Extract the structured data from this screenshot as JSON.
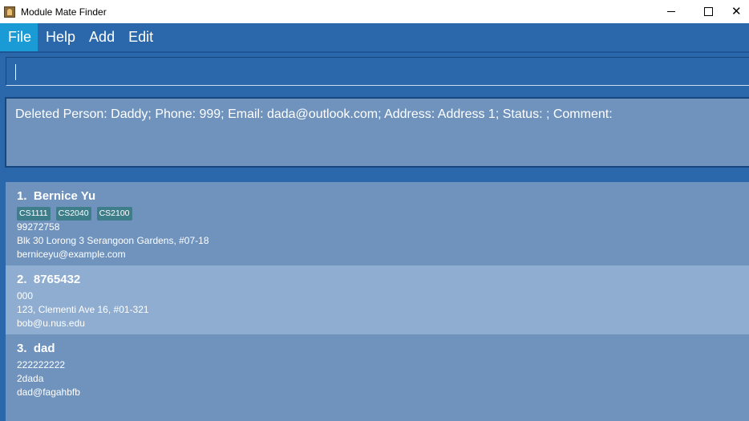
{
  "window": {
    "title": "Module Mate Finder",
    "controls": {
      "minimize": "minimize",
      "maximize": "maximize",
      "close": "close"
    }
  },
  "menu": {
    "items": [
      {
        "label": "File",
        "active": true
      },
      {
        "label": "Help",
        "active": false
      },
      {
        "label": "Add",
        "active": false
      },
      {
        "label": "Edit",
        "active": false
      }
    ]
  },
  "command": {
    "value": ""
  },
  "result": {
    "message": "Deleted Person: Daddy; Phone: 999; Email: dada@outlook.com; Address: Address 1; Status: ; Comment:"
  },
  "persons": [
    {
      "index": "1.",
      "name": "Bernice Yu",
      "tags": [
        "CS1111",
        "CS2040",
        "CS2100"
      ],
      "phone": "99272758",
      "address": "Blk 30 Lorong 3 Serangoon Gardens, #07-18",
      "email": "berniceyu@example.com"
    },
    {
      "index": "2.",
      "name": "8765432",
      "tags": [],
      "phone": "000",
      "address": "123, Clementi Ave 16, #01-321",
      "email": "bob@u.nus.edu"
    },
    {
      "index": "3.",
      "name": "dad",
      "tags": [],
      "phone": "222222222",
      "address": "2dada",
      "email": "dad@fagahbfb"
    }
  ],
  "colors": {
    "menubar": "#2a68ab",
    "menu_active": "#1a9bd6",
    "panel": "#6f93bd",
    "card_alt": "#8fadd0",
    "tag": "#3e7d8a"
  }
}
